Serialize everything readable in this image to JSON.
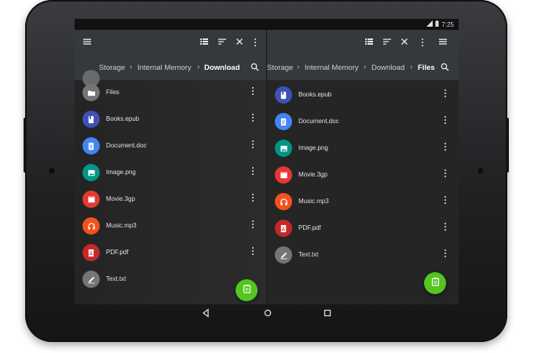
{
  "status_bar": {
    "time": "7:25"
  },
  "left_pane": {
    "breadcrumb": [
      "Storage",
      "Internal Memory",
      "Download"
    ],
    "items": [
      {
        "label": "Files",
        "icon": "folder-icon",
        "color": "#757575"
      },
      {
        "label": "Books.epub",
        "icon": "book-icon",
        "color": "#3f51b5"
      },
      {
        "label": "Document.doc",
        "icon": "document-icon",
        "color": "#4285f4"
      },
      {
        "label": "Image.png",
        "icon": "image-icon",
        "color": "#009688"
      },
      {
        "label": "Movie.3gp",
        "icon": "movie-icon",
        "color": "#e53935"
      },
      {
        "label": "Music.mp3",
        "icon": "headphones-icon",
        "color": "#f4511e"
      },
      {
        "label": "PDF.pdf",
        "icon": "pdf-icon",
        "color": "#c62828"
      },
      {
        "label": "Text.txt",
        "icon": "pencil-icon",
        "color": "#757575"
      }
    ]
  },
  "right_pane": {
    "breadcrumb": [
      "Storage",
      "Internal Memory",
      "Download",
      "Files"
    ],
    "items": [
      {
        "label": "Books.epub",
        "icon": "book-icon",
        "color": "#3f51b5"
      },
      {
        "label": "Document.doc",
        "icon": "document-icon",
        "color": "#4285f4"
      },
      {
        "label": "Image.png",
        "icon": "image-icon",
        "color": "#009688"
      },
      {
        "label": "Movie.3gp",
        "icon": "movie-icon",
        "color": "#e53935"
      },
      {
        "label": "Music.mp3",
        "icon": "headphones-icon",
        "color": "#f4511e"
      },
      {
        "label": "PDF.pdf",
        "icon": "pdf-icon",
        "color": "#c62828"
      },
      {
        "label": "Text.txt",
        "icon": "pencil-icon",
        "color": "#757575"
      }
    ]
  },
  "fab_color": "#54c61f",
  "app_bar_color": "#33393c"
}
